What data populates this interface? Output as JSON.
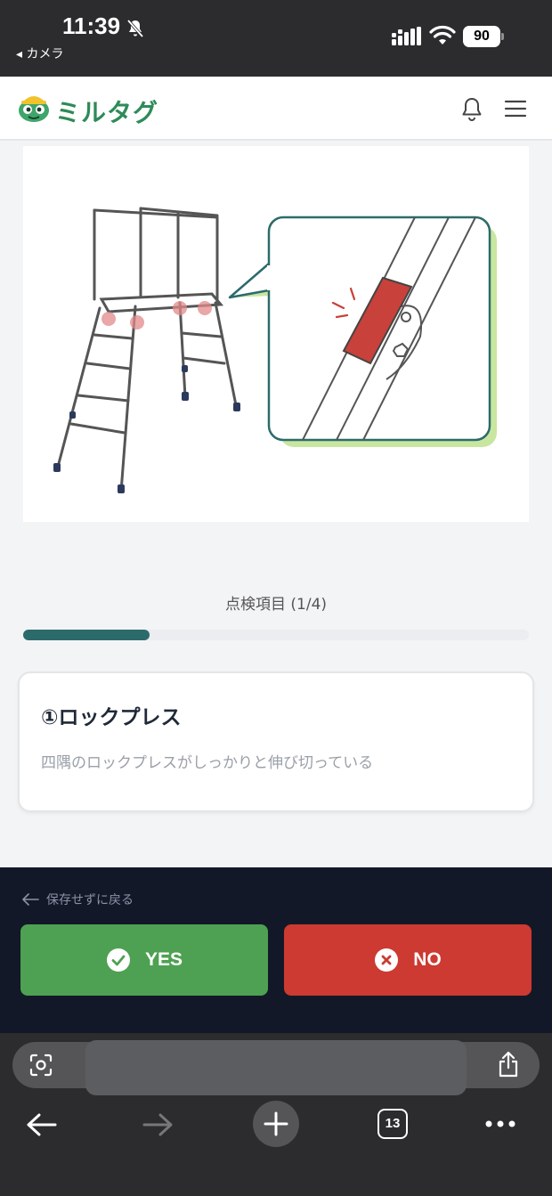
{
  "status_bar": {
    "time": "11:39",
    "back_app": "◂ カメラ",
    "battery": "90"
  },
  "header": {
    "logo_text": "ミルタグ",
    "bell_icon": "bell-icon",
    "menu_icon": "menu-icon"
  },
  "inspection": {
    "progress_label": "点検項目 (1/4)",
    "progress_fraction": 0.25,
    "item_title": "①ロックプレス",
    "item_description": "四隅のロックプレスがしっかりと伸び切っている"
  },
  "actions": {
    "back_label": "保存せずに戻る",
    "yes_label": "YES",
    "no_label": "NO"
  },
  "browser": {
    "tab_count": "13"
  },
  "colors": {
    "brand_green": "#2e8b57",
    "progress_fill": "#2c6b6b",
    "yes_button": "#4ea152",
    "no_button": "#cc3a31",
    "panel_bg": "#131829"
  }
}
